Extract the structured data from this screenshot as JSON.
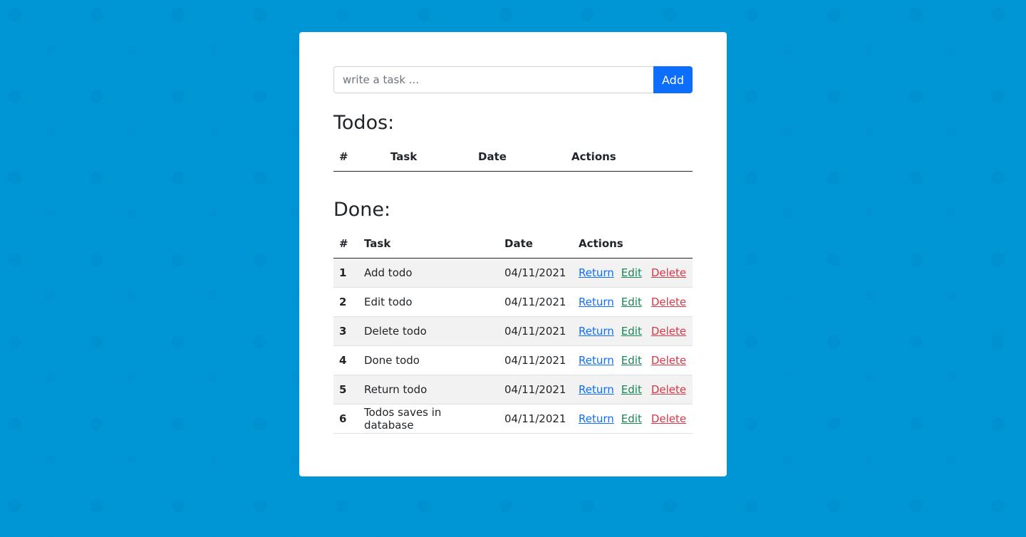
{
  "form": {
    "placeholder": "write a task ...",
    "add_label": "Add"
  },
  "todos": {
    "title": "Todos:",
    "headers": {
      "num": "#",
      "task": "Task",
      "date": "Date",
      "actions": "Actions"
    }
  },
  "done": {
    "title": "Done:",
    "headers": {
      "num": "#",
      "task": "Task",
      "date": "Date",
      "actions": "Actions"
    },
    "rows": [
      {
        "num": "1",
        "task": "Add todo",
        "date": "04/11/2021",
        "return": "Return",
        "edit": "Edit",
        "delete": "Delete"
      },
      {
        "num": "2",
        "task": "Edit todo",
        "date": "04/11/2021",
        "return": "Return",
        "edit": "Edit",
        "delete": "Delete"
      },
      {
        "num": "3",
        "task": "Delete todo",
        "date": "04/11/2021",
        "return": "Return",
        "edit": "Edit",
        "delete": "Delete"
      },
      {
        "num": "4",
        "task": "Done todo",
        "date": "04/11/2021",
        "return": "Return",
        "edit": "Edit",
        "delete": "Delete"
      },
      {
        "num": "5",
        "task": "Return todo",
        "date": "04/11/2021",
        "return": "Return",
        "edit": "Edit",
        "delete": "Delete"
      },
      {
        "num": "6",
        "task": "Todos saves in database",
        "date": "04/11/2021",
        "return": "Return",
        "edit": "Edit",
        "delete": "Delete"
      }
    ]
  },
  "colors": {
    "background": "#0096d6",
    "primary": "#0d6efd",
    "success": "#198754",
    "danger": "#dc3545"
  }
}
